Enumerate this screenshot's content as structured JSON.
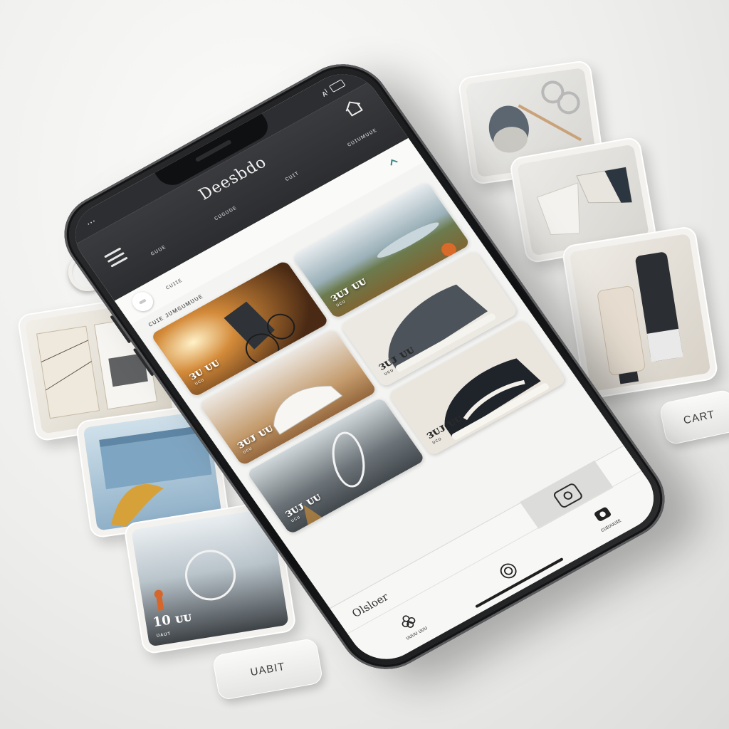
{
  "status_bar": {
    "carrier": "⋯",
    "indicators": "ᴀᴵ"
  },
  "header": {
    "brand": "Deesbdo",
    "tabs": [
      "ɢᴜᴜᴇ",
      "ᴄᴜɢᴜᴅᴇ",
      "ᴄᴜɪᴛ",
      "ᴄᴜɪᴜᴍᴜᴜᴇ"
    ]
  },
  "filter": {
    "label": "ᴄᴜɪɪᴇ"
  },
  "section": {
    "title": "ᴄᴜɪᴇ ᴊᴜᴍɢᴜᴍᴜᴜᴇ"
  },
  "products": [
    {
      "price": "ᴈᴜ ᴜᴜ",
      "sub": "ᴜᴄᴜ",
      "scene": "sunset-chair"
    },
    {
      "price": "ᴈᴜᴊ ᴜᴜ",
      "sub": "ᴜᴄᴜ",
      "scene": "landscape"
    },
    {
      "price": "ᴈᴜᴊ ᴜᴜ",
      "sub": "ᴜᴄᴜ",
      "scene": "white-sneaker"
    },
    {
      "price": "ᴈᴜᴊ ᴜᴜ",
      "sub": "ᴜᴄᴜ",
      "scene": "grey-sneaker"
    },
    {
      "price": "ᴈᴜᴊ ᴜᴜ",
      "sub": "ᴜᴄᴜ",
      "scene": "racket-sunset"
    },
    {
      "price": "ᴈᴜᴊ ᴜᴜ",
      "sub": "ᴜᴄᴜ",
      "scene": "black-sneaker"
    }
  ],
  "order": {
    "label": "Olsloer"
  },
  "tab_bar": [
    {
      "icon": "flower-icon",
      "label": "ᴜᴜᴜᴜ ᴜᴜᴜ"
    },
    {
      "icon": "target-icon",
      "label": ""
    },
    {
      "icon": "camera-icon",
      "label": "ᴄᴜɪᴜᴜᴜɪᴇ"
    }
  ],
  "tiles": {
    "cart_pill": "CART",
    "uabit_pill": "UABIT",
    "beach_tile_price": "10 ᴜᴜ",
    "beach_tile_sub": "ᴜᴀᴜᴛ"
  },
  "colors": {
    "header": "#2d2e31",
    "screen": "#f4f4f2",
    "frame": "#141415",
    "background": "#eeeeec"
  }
}
